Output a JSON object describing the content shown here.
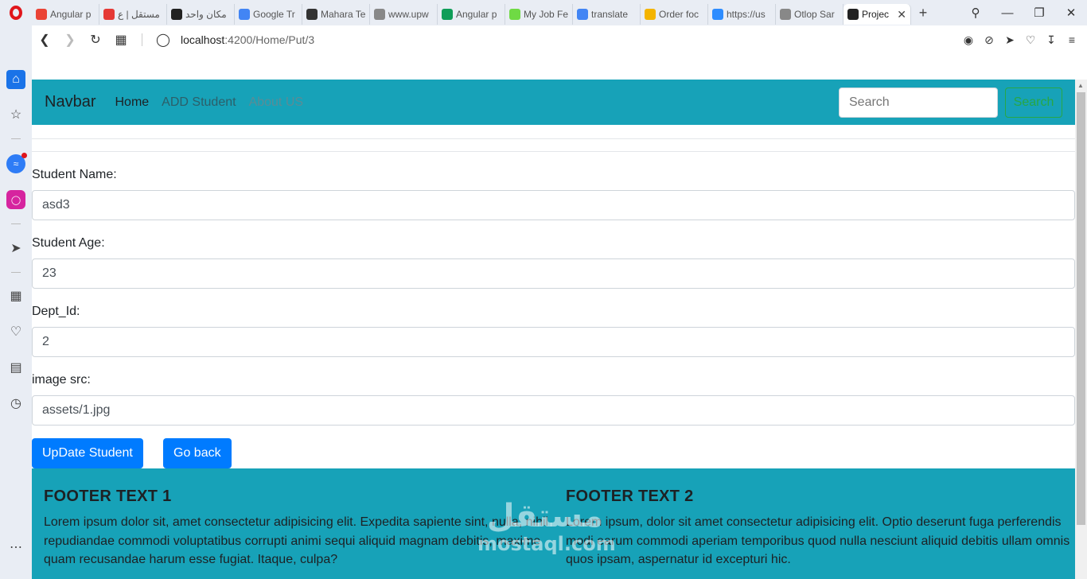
{
  "browser": {
    "tabs": [
      {
        "label": "Angular p",
        "favicon_color": "#ea4335",
        "icon": "gmail-icon"
      },
      {
        "label": "مستقل | ع",
        "favicon_color": "#e53935",
        "icon": "mostaql-icon"
      },
      {
        "label": "مكان واحد",
        "favicon_color": "#222222",
        "icon": "circle-icon"
      },
      {
        "label": "Google Tr",
        "favicon_color": "#4285f4",
        "icon": "translate-icon"
      },
      {
        "label": "Mahara Te",
        "favicon_color": "#333333",
        "icon": "mahara-icon"
      },
      {
        "label": "www.upw",
        "favicon_color": "#888888",
        "icon": "document-icon"
      },
      {
        "label": "Angular p",
        "favicon_color": "#0f9d58",
        "icon": "drive-icon"
      },
      {
        "label": "My Job Fe",
        "favicon_color": "#6fda44",
        "icon": "upwork-icon"
      },
      {
        "label": "translate",
        "favicon_color": "#4285f4",
        "icon": "google-icon"
      },
      {
        "label": "Order foc",
        "favicon_color": "#f4b400",
        "icon": "order-icon"
      },
      {
        "label": "https://us",
        "favicon_color": "#2d8cff",
        "icon": "zoom-icon"
      },
      {
        "label": "Otlop Sar",
        "favicon_color": "#888888",
        "icon": "document-icon"
      },
      {
        "label": "Projec",
        "favicon_color": "#222222",
        "icon": "angular-icon",
        "active": true
      }
    ],
    "new_tab": "+",
    "url_host": "localhost",
    "url_path": ":4200/Home/Put/3"
  },
  "navbar": {
    "brand": "Navbar",
    "links": [
      "Home",
      "ADD Student",
      "About US"
    ],
    "search_placeholder": "Search",
    "search_button": "Search"
  },
  "form": {
    "name_label": "Student Name:",
    "name_value": "asd3",
    "age_label": "Student Age:",
    "age_value": "23",
    "dept_label": "Dept_Id:",
    "dept_value": "2",
    "image_label": "image src:",
    "image_value": "assets/1.jpg",
    "update_button": "UpDate Student",
    "back_button": "Go back"
  },
  "footer": {
    "col1_title": "FOOTER TEXT 1",
    "col1_text": "Lorem ipsum dolor sit, amet consectetur adipisicing elit. Expedita sapiente sint, nulla, nihil repudiandae commodi voluptatibus corrupti animi sequi aliquid magnam debitis, maxime quam recusandae harum esse fugiat. Itaque, culpa?",
    "col2_title": "FOOTER TEXT 2",
    "col2_text": "Lorem ipsum, dolor sit amet consectetur adipisicing elit. Optio deserunt fuga perferendis modi earum commodi aperiam temporibus quod nulla nesciunt aliquid debitis ullam omnis quos ipsam, aspernatur id excepturi hic."
  },
  "watermark": {
    "arabic": "مستقل",
    "latin": "mostaql.com"
  },
  "colors": {
    "navbar": "#17a2b8",
    "primary": "#007bff",
    "success": "#28a745"
  }
}
